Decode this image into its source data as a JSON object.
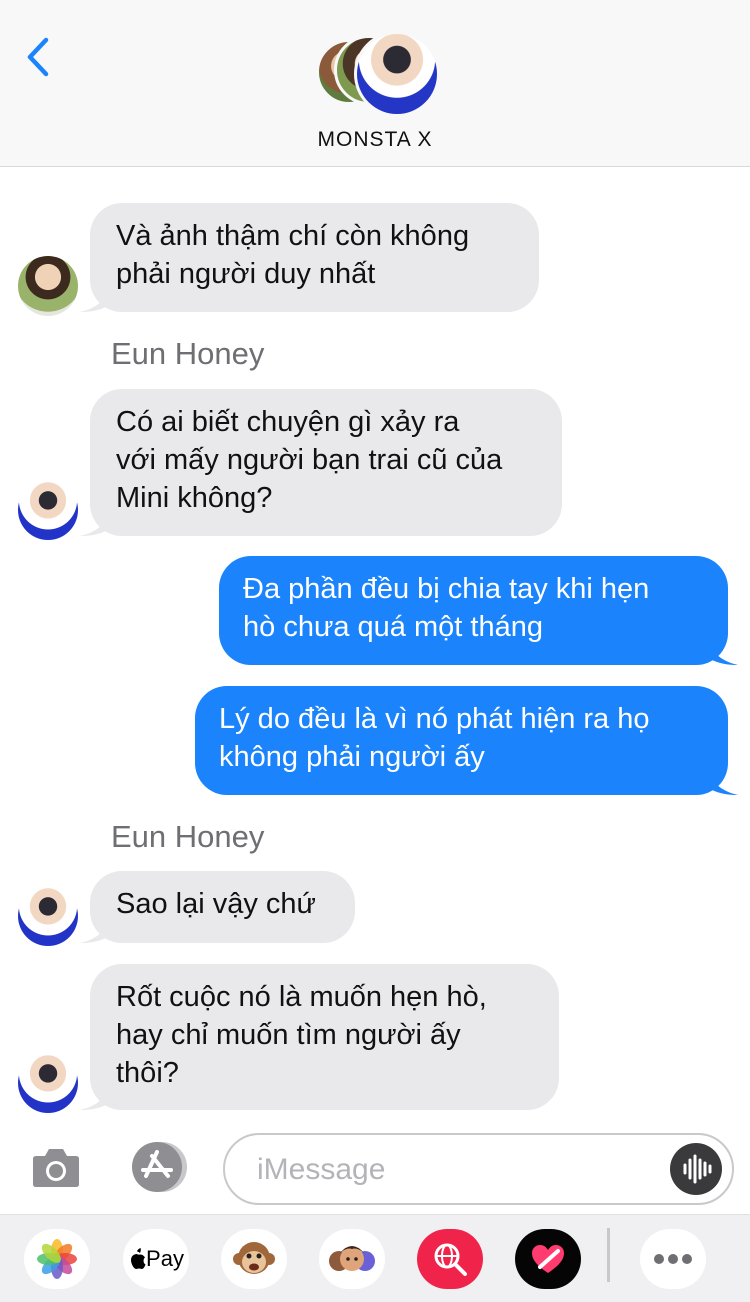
{
  "header": {
    "title": "MONSTA X",
    "back_icon": "chevron-left-icon",
    "accent_color": "#1b84fd"
  },
  "messages": [
    {
      "direction": "in",
      "sender": "",
      "lines": [
        "Và ảnh thậm chí còn không",
        "phải người duy nhất"
      ]
    },
    {
      "direction": "in",
      "sender": "Eun Honey",
      "lines": [
        "Có ai biết chuyện gì xảy ra",
        "với mấy người bạn trai cũ của",
        "Mini không?"
      ]
    },
    {
      "direction": "out",
      "sender": "",
      "lines": [
        "Đa phần đều bị chia tay khi hẹn",
        "hò chưa quá một tháng"
      ]
    },
    {
      "direction": "out",
      "sender": "",
      "lines": [
        "Lý do đều là vì nó phát hiện ra họ",
        "không phải người ấy"
      ]
    },
    {
      "direction": "in",
      "sender": "Eun Honey",
      "lines": [
        "Sao lại vậy chứ"
      ]
    },
    {
      "direction": "in",
      "sender": "",
      "lines": [
        "Rốt cuộc nó là muốn hẹn hò,",
        "hay chỉ muốn tìm người ấy",
        "thôi?"
      ]
    }
  ],
  "composer": {
    "placeholder": "iMessage",
    "camera_icon": "camera-icon",
    "apps_icon": "app-store-icon",
    "audio_icon": "audio-waveform-icon"
  },
  "app_drawer": {
    "items": [
      "photos-icon",
      "apple-pay-icon",
      "animoji-monkey-icon",
      "memoji-stickers-icon",
      "web-search-icon",
      "digital-touch-icon",
      "more-icon"
    ],
    "pay_label": "Pay"
  }
}
